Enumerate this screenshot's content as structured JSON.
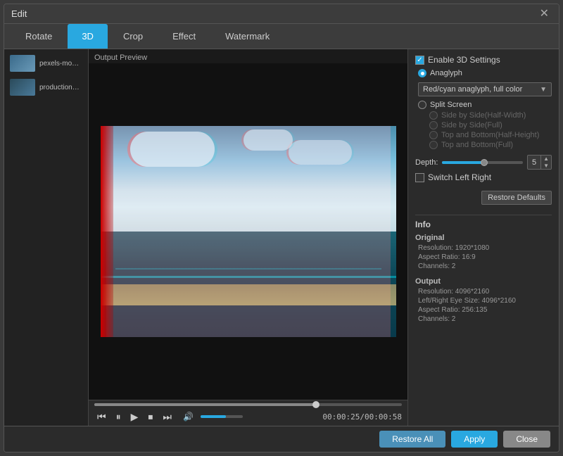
{
  "window": {
    "title": "Edit"
  },
  "tabs": [
    {
      "id": "rotate",
      "label": "Rotate",
      "active": false
    },
    {
      "id": "3d",
      "label": "3D",
      "active": true
    },
    {
      "id": "crop",
      "label": "Crop",
      "active": false
    },
    {
      "id": "effect",
      "label": "Effect",
      "active": false
    },
    {
      "id": "watermark",
      "label": "Watermark",
      "active": false
    }
  ],
  "sidebar": {
    "items": [
      {
        "label": "pexels-movie..."
      },
      {
        "label": "production_id..."
      }
    ]
  },
  "preview": {
    "label": "Output Preview"
  },
  "playback": {
    "time": "00:00:25/00:00:58"
  },
  "settings_3d": {
    "enable_label": "Enable 3D Settings",
    "anaglyph_label": "Anaglyph",
    "anaglyph_option": "Red/cyan anaglyph, full color",
    "split_screen_label": "Split Screen",
    "side_by_side_half": "Side by Side(Half-Width)",
    "side_by_side_full": "Side by Side(Full)",
    "top_bottom_half": "Top and Bottom(Half-Height)",
    "top_bottom_full": "Top and Bottom(Full)",
    "depth_label": "Depth:",
    "depth_value": "5",
    "switch_left_right": "Switch Left Right"
  },
  "info": {
    "title": "Info",
    "original_label": "Original",
    "original_resolution": "Resolution: 1920*1080",
    "original_aspect": "Aspect Ratio: 16:9",
    "original_channels": "Channels: 2",
    "output_label": "Output",
    "output_resolution": "Resolution: 4096*2160",
    "output_eye_size": "Left/Right Eye Size: 4096*2160",
    "output_aspect": "Aspect Ratio: 256:135",
    "output_channels": "Channels: 2"
  },
  "buttons": {
    "restore_defaults": "Restore Defaults",
    "restore_all": "Restore All",
    "apply": "Apply",
    "close": "Close"
  }
}
